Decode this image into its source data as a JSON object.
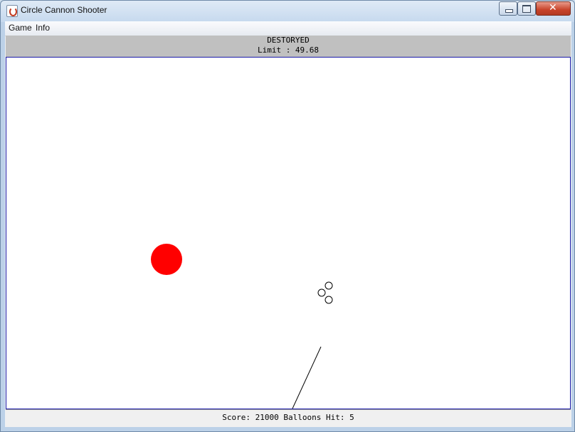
{
  "window": {
    "title": "Circle Cannon Shooter",
    "controls": {
      "minimize": "minimize",
      "maximize": "maximize",
      "close": "✕"
    }
  },
  "menubar": {
    "items": [
      {
        "label": "Game"
      },
      {
        "label": "Info"
      }
    ]
  },
  "status_top": {
    "state_text": "DESTORYED",
    "limit_text": "Limit : 49.68"
  },
  "game": {
    "background_color": "#ffffff",
    "target_color": "#ff0000",
    "projectile_count": 3
  },
  "status_bottom": {
    "score_text": "Score: 21000 Balloons Hit: 5"
  },
  "colors": {
    "status_top_bg": "#c0c0c0",
    "game_border": "#1a1aa8",
    "close_button": "#c8432a"
  }
}
